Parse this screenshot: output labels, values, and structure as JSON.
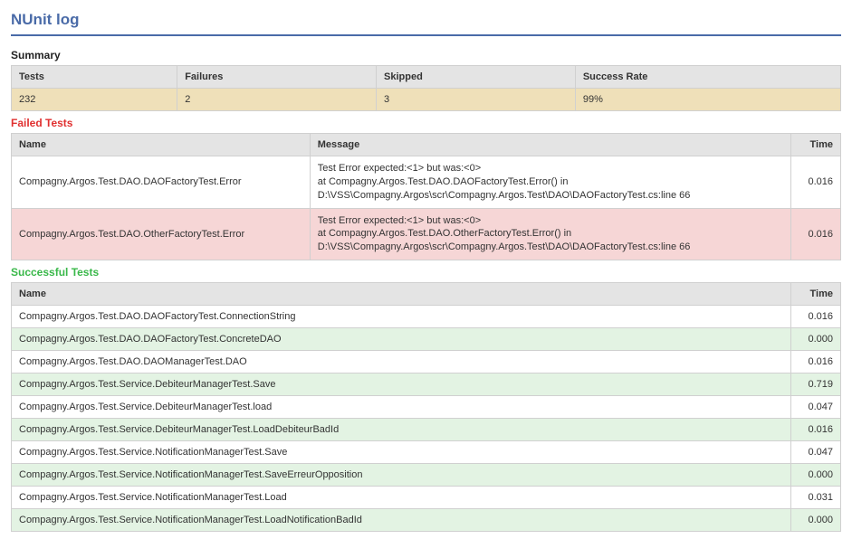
{
  "title": "NUnit log",
  "summary": {
    "heading": "Summary",
    "headers": {
      "tests": "Tests",
      "failures": "Failures",
      "skipped": "Skipped",
      "success_rate": "Success Rate"
    },
    "values": {
      "tests": "232",
      "failures": "2",
      "skipped": "3",
      "success_rate": "99%"
    }
  },
  "failed": {
    "heading": "Failed Tests",
    "headers": {
      "name": "Name",
      "message": "Message",
      "time": "Time"
    },
    "rows": [
      {
        "name": "Compagny.Argos.Test.DAO.DAOFactoryTest.Error",
        "message": "Test Error expected:<1> but was:<0>\nat Compagny.Argos.Test.DAO.DAOFactoryTest.Error() in\nD:\\VSS\\Compagny.Argos\\scr\\Compagny.Argos.Test\\DAO\\DAOFactoryTest.cs:line 66",
        "time": "0.016"
      },
      {
        "name": "Compagny.Argos.Test.DAO.OtherFactoryTest.Error",
        "message": "Test Error expected:<1> but was:<0>\nat Compagny.Argos.Test.DAO.OtherFactoryTest.Error() in\nD:\\VSS\\Compagny.Argos\\scr\\Compagny.Argos.Test\\DAO\\DAOFactoryTest.cs:line 66",
        "time": "0.016"
      }
    ]
  },
  "success": {
    "heading": "Successful Tests",
    "headers": {
      "name": "Name",
      "time": "Time"
    },
    "rows": [
      {
        "name": "Compagny.Argos.Test.DAO.DAOFactoryTest.ConnectionString",
        "time": "0.016"
      },
      {
        "name": "Compagny.Argos.Test.DAO.DAOFactoryTest.ConcreteDAO",
        "time": "0.000"
      },
      {
        "name": "Compagny.Argos.Test.DAO.DAOManagerTest.DAO",
        "time": "0.016"
      },
      {
        "name": "Compagny.Argos.Test.Service.DebiteurManagerTest.Save",
        "time": "0.719"
      },
      {
        "name": "Compagny.Argos.Test.Service.DebiteurManagerTest.load",
        "time": "0.047"
      },
      {
        "name": "Compagny.Argos.Test.Service.DebiteurManagerTest.LoadDebiteurBadId",
        "time": "0.016"
      },
      {
        "name": "Compagny.Argos.Test.Service.NotificationManagerTest.Save",
        "time": "0.047"
      },
      {
        "name": "Compagny.Argos.Test.Service.NotificationManagerTest.SaveErreurOpposition",
        "time": "0.000"
      },
      {
        "name": "Compagny.Argos.Test.Service.NotificationManagerTest.Load",
        "time": "0.031"
      },
      {
        "name": "Compagny.Argos.Test.Service.NotificationManagerTest.LoadNotificationBadId",
        "time": "0.000"
      }
    ]
  }
}
